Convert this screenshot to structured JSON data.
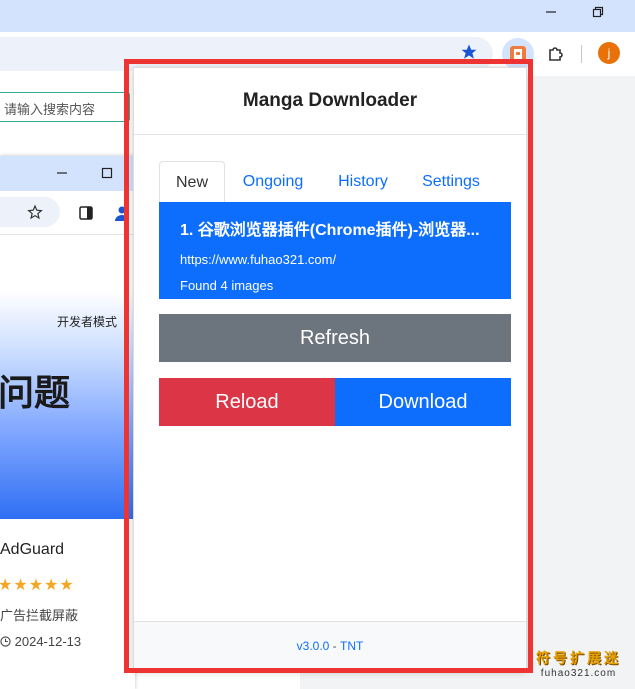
{
  "browser": {
    "omnibox_icon": "star-icon",
    "avatar_letter": "j",
    "search_placeholder": "请输入搜索内容"
  },
  "background_page": {
    "dev_mode": "开发者模式",
    "hero_text": "问题",
    "card": {
      "name": "AdGuard",
      "stars": "★★★★★",
      "description": "广告拦截屏蔽",
      "date": "2024-12-13"
    }
  },
  "popup": {
    "title": "Manga Downloader",
    "tabs": [
      {
        "label": "New",
        "active": true
      },
      {
        "label": "Ongoing",
        "active": false
      },
      {
        "label": "History",
        "active": false
      },
      {
        "label": "Settings",
        "active": false
      }
    ],
    "item": {
      "title": "1. 谷歌浏览器插件(Chrome插件)-浏览器...",
      "url": "https://www.fuhao321.com/",
      "found": "Found 4 images"
    },
    "buttons": {
      "refresh": "Refresh",
      "reload": "Reload",
      "download": "Download"
    },
    "footer": {
      "version": "v3.0.0",
      "separator": " - ",
      "author": "TNT"
    }
  },
  "watermark": {
    "top": "符号扩展迷",
    "bottom": "fuhao321.com"
  },
  "colors": {
    "primary": "#0d6efd",
    "secondary": "#6c757d",
    "danger": "#dc3545",
    "highlight_frame": "#ee3333"
  }
}
